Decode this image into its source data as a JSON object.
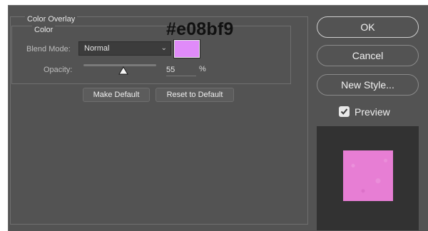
{
  "annotation": {
    "hex_text": "#e08bf9"
  },
  "group": {
    "title": "Color Overlay",
    "subtitle": "Color"
  },
  "blend": {
    "label": "Blend Mode:",
    "value": "Normal",
    "chevron_icon": "chevron-down-icon"
  },
  "color": {
    "swatch_hex": "#e08bf9"
  },
  "opacity": {
    "label": "Opacity:",
    "value": "55",
    "unit": "%",
    "level_percent": 55
  },
  "buttons": {
    "make_default": "Make Default",
    "reset_default": "Reset to Default",
    "ok": "OK",
    "cancel": "Cancel",
    "new_style": "New Style..."
  },
  "preview": {
    "label": "Preview",
    "checked": true,
    "preview_fill": "#e77ed4"
  }
}
